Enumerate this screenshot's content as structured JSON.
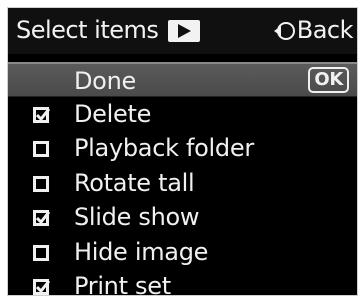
{
  "header": {
    "title": "Select items",
    "back_label": "Back"
  },
  "done": {
    "label": "Done",
    "ok_label": "OK"
  },
  "items": [
    {
      "label": "Delete",
      "checked": true
    },
    {
      "label": "Playback folder",
      "checked": false
    },
    {
      "label": "Rotate tall",
      "checked": false
    },
    {
      "label": "Slide show",
      "checked": true
    },
    {
      "label": "Hide image",
      "checked": false
    },
    {
      "label": "Print set",
      "checked": true
    }
  ]
}
